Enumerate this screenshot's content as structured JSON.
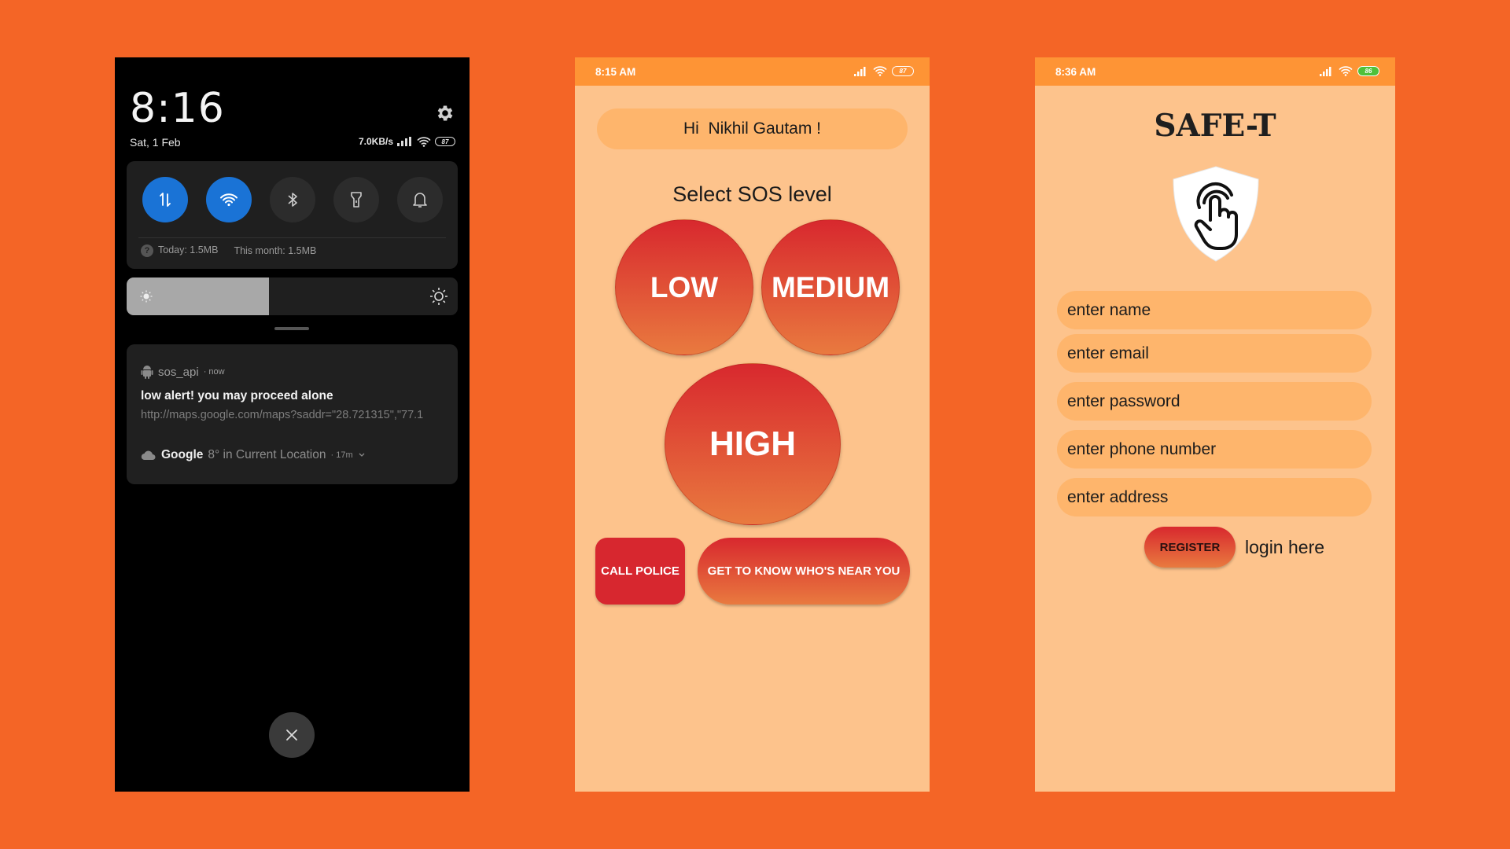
{
  "colors": {
    "background": "#f46526",
    "accent_on": "#1a73d6",
    "sos_gradient_top": "#d8282e",
    "sos_gradient_bottom": "#e97a3f",
    "panel_peach": "#fdc38c",
    "field_orange": "#feb56c",
    "status_orange": "#fe9435"
  },
  "phone1": {
    "clock": "8:16",
    "date": "Sat, 1 Feb",
    "net_speed": "7.0KB/s",
    "battery": "87",
    "quick_toggles": [
      {
        "name": "mobile-data",
        "icon": "data-arrows-icon",
        "on": true
      },
      {
        "name": "wifi",
        "icon": "wifi-icon",
        "on": true
      },
      {
        "name": "bluetooth",
        "icon": "bluetooth-icon",
        "on": false
      },
      {
        "name": "flashlight",
        "icon": "flashlight-icon",
        "on": false
      },
      {
        "name": "bell",
        "icon": "bell-icon",
        "on": false
      }
    ],
    "usage_today": "Today: 1.5MB",
    "usage_month": "This month: 1.5MB",
    "brightness_level": 0.43,
    "notification": {
      "app": "sos_api",
      "time": "· now",
      "title": "low alert! you may proceed alone",
      "url": "http://maps.google.com/maps?saddr=\"28.721315\",\"77.1"
    },
    "weather": {
      "source": "Google",
      "text": "8° in Current Location",
      "age": "· 17m"
    }
  },
  "phone2": {
    "time": "8:15 AM",
    "battery": "87",
    "greeting": "Hi  Nikhil Gautam !",
    "sos_title": "Select SOS level",
    "levels": {
      "low": "LOW",
      "medium": "MEDIUM",
      "high": "HIGH"
    },
    "call_police": "CALL POLICE",
    "near_you": "GET TO KNOW WHO'S NEAR YOU"
  },
  "phone3": {
    "time": "8:36 AM",
    "battery": "86",
    "brand": "SAFE-T",
    "fields": {
      "name": "enter name",
      "email": "enter email",
      "password": "enter password",
      "phone": "enter phone number",
      "address": "enter address"
    },
    "register": "REGISTER",
    "login": "login here"
  }
}
